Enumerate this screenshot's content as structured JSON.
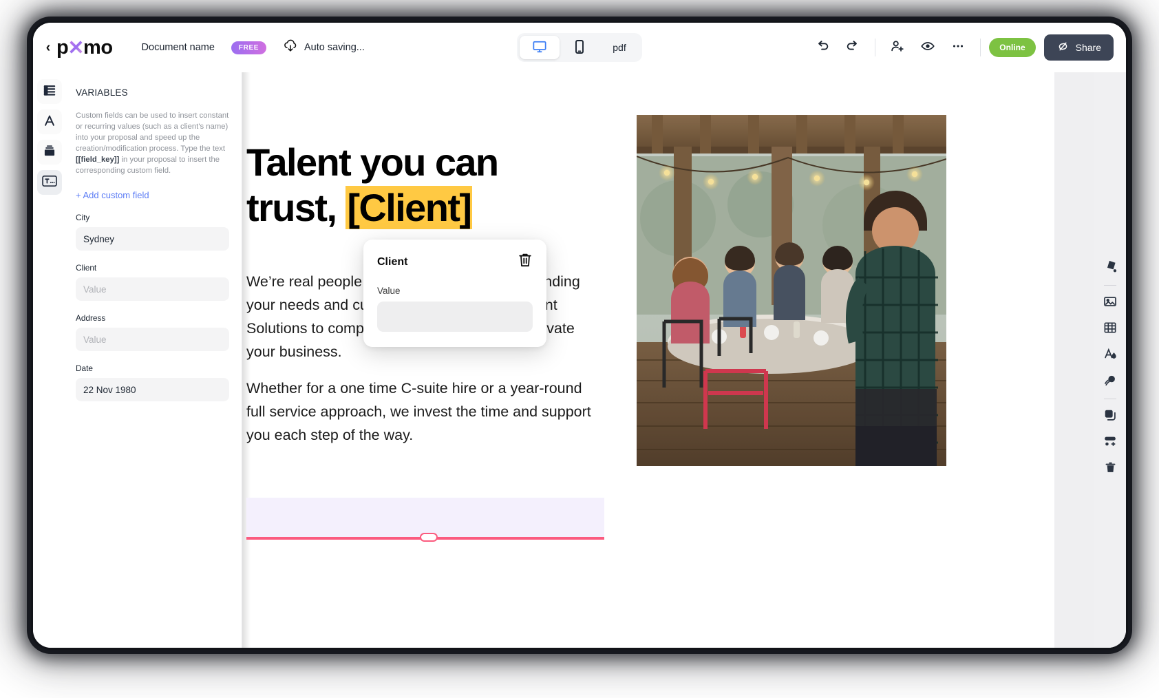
{
  "topbar": {
    "back_label": "‹",
    "logo": {
      "part1": "p",
      "x": "✕",
      "part3": "mo"
    },
    "document_name": "Document name",
    "plan_badge": "FREE",
    "autosave_text": "Auto saving...",
    "cloud_icon": "cloud-sync-icon"
  },
  "viewmodes": [
    {
      "id": "desktop",
      "icon": "desktop-icon",
      "label": "",
      "active": true
    },
    {
      "id": "mobile",
      "icon": "mobile-icon",
      "label": "",
      "active": false
    },
    {
      "id": "pdf",
      "icon": "",
      "label": "pdf",
      "active": false
    }
  ],
  "topright": {
    "undo": "undo-icon",
    "redo": "redo-icon",
    "invite": "add-user-icon",
    "preview": "eye-icon",
    "more": "more-options-icon",
    "online_label": "Online",
    "share_label": "Share",
    "share_icon": "link-off-icon"
  },
  "rail": [
    {
      "name": "content-blocks",
      "icon": "layout-list-icon",
      "selected": false
    },
    {
      "name": "typography",
      "icon": "text-a-icon",
      "selected": false
    },
    {
      "name": "brand-assets",
      "icon": "layers-stack-icon",
      "selected": false
    },
    {
      "name": "variables",
      "icon": "variables-t-icon",
      "selected": true
    }
  ],
  "panel": {
    "title": "VARIABLES",
    "description_1": "Custom fields can be used to insert constant or recurring values (such as a client's name) into your proposal and speed up the creation/modification process. Type the text ",
    "description_code": "[[field_key]]",
    "description_2": " in your proposal to insert the corresponding custom field.",
    "add_field_label": "+ Add custom field",
    "fields": [
      {
        "label": "City",
        "value": "Sydney",
        "placeholder": "Value"
      },
      {
        "label": "Client",
        "value": "",
        "placeholder": "Value"
      },
      {
        "label": "Address",
        "value": "",
        "placeholder": "Value"
      },
      {
        "label": "Date",
        "value": "22 Nov 1980",
        "placeholder": "Value"
      }
    ]
  },
  "document": {
    "heading_part1": "Talent you can trust, ",
    "heading_highlight": "[Client]",
    "paragraph_1": "We’re real people who take the time understanding your needs and curating Executive Recruitment Solutions to complement your journey and elevate your business.",
    "paragraph_2": "Whether for a one time C-suite hire or a year-round full service approach, we invest the time and support you each step of the way.",
    "photo_alt": "group of people seated around a table at an outdoor patio event with a man presenting"
  },
  "variable_popup": {
    "title": "Client",
    "delete_icon": "trash-icon",
    "value_label": "Value",
    "value": "",
    "placeholder": ""
  },
  "right_rail": [
    {
      "name": "fill-color",
      "icon": "paint-bucket-icon"
    },
    {
      "name": "insert-image",
      "icon": "image-icon"
    },
    {
      "name": "insert-table",
      "icon": "table-icon"
    },
    {
      "name": "text-color",
      "icon": "text-color-icon"
    },
    {
      "name": "background-style",
      "icon": "palette-icon"
    },
    {
      "name": "duplicate-block",
      "icon": "duplicate-icon"
    },
    {
      "name": "add-block",
      "icon": "add-block-icon"
    },
    {
      "name": "delete-block",
      "icon": "trash-icon"
    }
  ],
  "colors": {
    "accent_blue": "#3b7df5",
    "link_blue": "#5b7cf5",
    "highlight_yellow": "#ffc943",
    "online_green": "#7dc242",
    "share_dark": "#3d4556",
    "pink_rule": "#fb5b7f",
    "lavender_block": "#f4f0fd"
  }
}
